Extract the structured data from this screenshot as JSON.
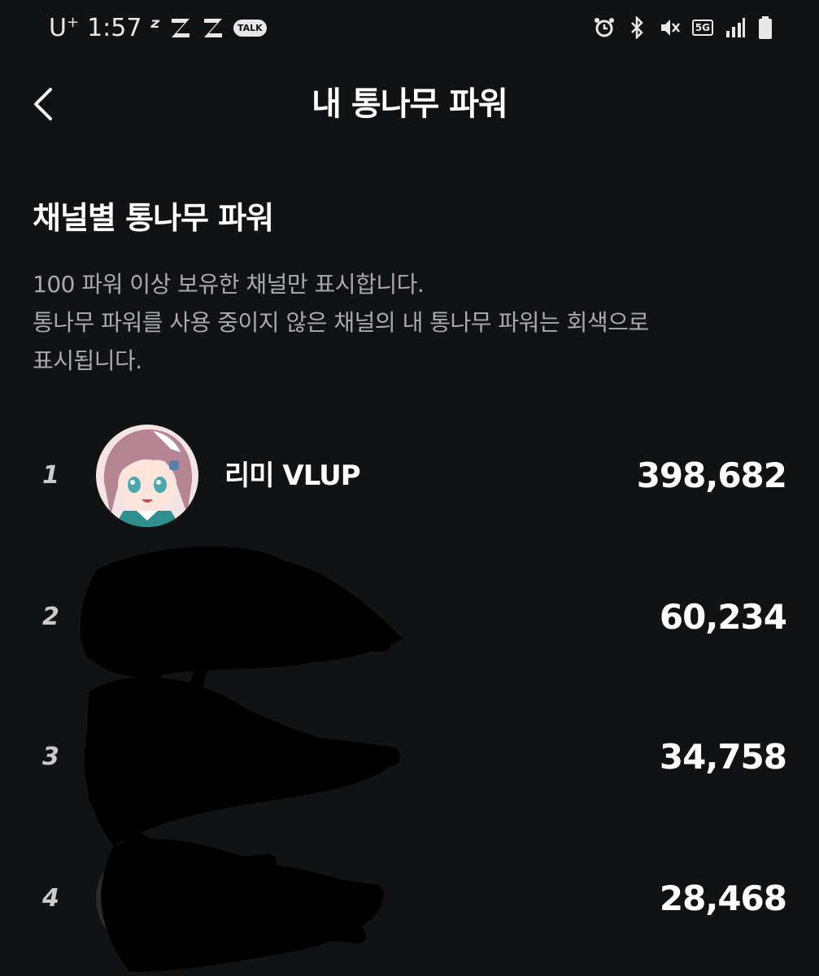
{
  "status_bar": {
    "carrier": "U",
    "carrier_sup": "+",
    "time": "1:57",
    "talk_badge": "TALK",
    "network": "5G"
  },
  "header": {
    "title": "내 통나무 파워"
  },
  "section": {
    "title": "채널별 통나무 파워",
    "description_lines": [
      "100 파워 이상 보유한 채널만 표시합니다.",
      "통나무 파워를 사용 중이지 않은 채널의 내 통나무 파워는 회색으로",
      "표시됩니다."
    ]
  },
  "ranking": [
    {
      "rank": "1",
      "name": "리미 VLUP",
      "power": "398,682"
    },
    {
      "rank": "2",
      "name": "",
      "power": "60,234"
    },
    {
      "rank": "3",
      "name": "",
      "power": "34,758"
    },
    {
      "rank": "4",
      "name": "",
      "power": "28,468"
    }
  ],
  "colors": {
    "background": "#111213",
    "text_primary": "#ffffff",
    "text_secondary": "#a9aaad"
  }
}
